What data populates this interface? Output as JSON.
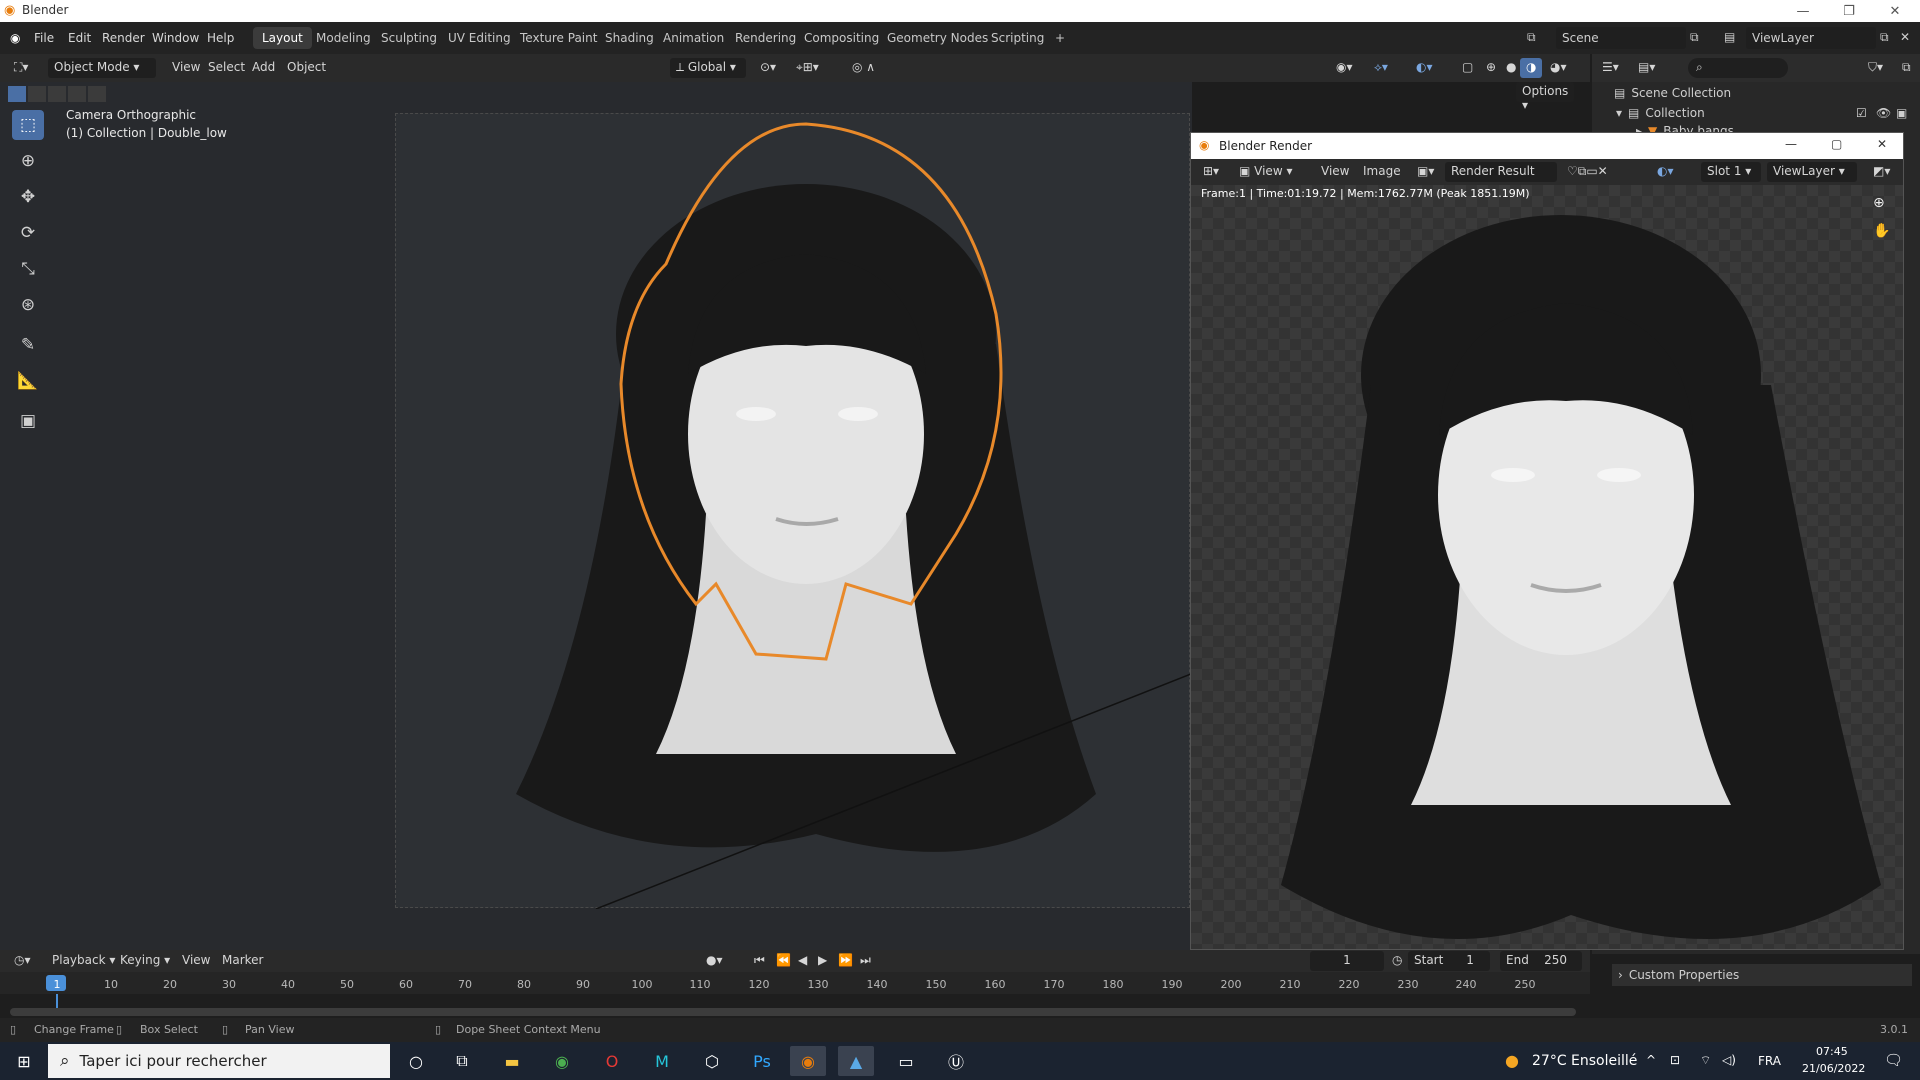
{
  "app": {
    "title": "Blender",
    "version": "3.0.1"
  },
  "menu": [
    "File",
    "Edit",
    "Render",
    "Window",
    "Help"
  ],
  "workspaces": [
    "Layout",
    "Modeling",
    "Sculpting",
    "UV Editing",
    "Texture Paint",
    "Shading",
    "Animation",
    "Rendering",
    "Compositing",
    "Geometry Nodes",
    "Scripting",
    "+"
  ],
  "active_workspace": "Layout",
  "scene": {
    "name": "Scene",
    "view_layer": "ViewLayer"
  },
  "header": {
    "mode": "Object Mode",
    "view": "View",
    "select": "Select",
    "add": "Add",
    "object": "Object",
    "transform": "Global",
    "options": "Options"
  },
  "viewport": {
    "line1": "Camera Orthographic",
    "line2": "(1) Collection | Double_low"
  },
  "outliner": {
    "scene_collection": "Scene Collection",
    "collection": "Collection",
    "item": "Baby bangs"
  },
  "render_window": {
    "title": "Blender Render",
    "menu": [
      "View",
      "View",
      "Image"
    ],
    "result": "Render Result",
    "slot": "Slot 1",
    "view_layer": "ViewLayer",
    "info": "Frame:1 | Time:01:19.72 | Mem:1762.77M (Peak 1851.19M)"
  },
  "timeline": {
    "menus": [
      "Playback",
      "Keying",
      "View",
      "Marker"
    ],
    "current_frame": "1",
    "start_label": "Start",
    "start": "1",
    "end_label": "End",
    "end": "250",
    "ticks": [
      "1",
      "10",
      "20",
      "30",
      "40",
      "50",
      "60",
      "70",
      "80",
      "90",
      "100",
      "110",
      "120",
      "130",
      "140",
      "150",
      "160",
      "170",
      "180",
      "190",
      "200",
      "210",
      "220",
      "230",
      "240",
      "250"
    ]
  },
  "properties": {
    "custom_properties": "Custom Properties"
  },
  "statusbar": {
    "change_frame": "Change Frame",
    "box_select": "Box Select",
    "pan_view": "Pan View",
    "context_menu": "Dope Sheet Context Menu",
    "version": "3.0.1"
  },
  "taskbar": {
    "search_placeholder": "Taper ici pour rechercher",
    "weather": "27°C Ensoleillé",
    "lang": "FRA",
    "time": "07:45",
    "date": "21/06/2022"
  },
  "colors": {
    "accent": "#4a6fa5",
    "selection_outline": "#e8892a",
    "frame_marker": "#4a90d9"
  }
}
